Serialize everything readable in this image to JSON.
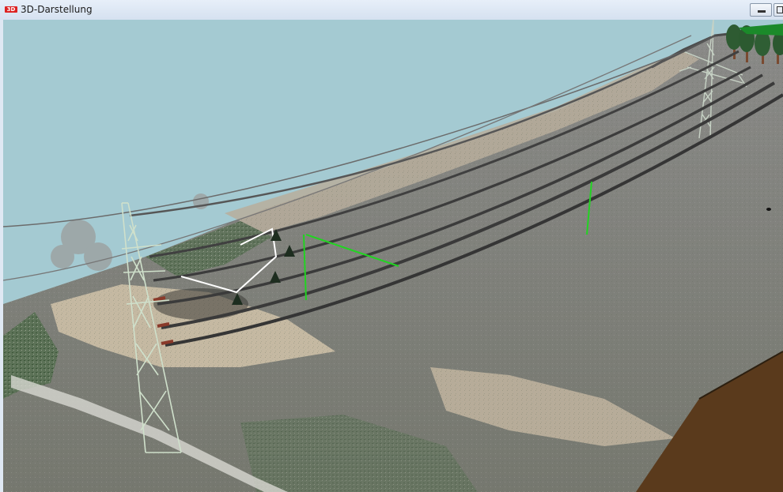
{
  "window": {
    "title": "3D-Darstellung",
    "app_icon_text": "3D",
    "minimize_icon": "minimize-icon",
    "restore_icon": "restore-icon"
  },
  "scene": {
    "type": "3d-point-cloud-view",
    "colors": {
      "sky": "#a4cad2",
      "ground": "#7d7d7d",
      "field": "#c7bba4",
      "soil": "#5a3a1c",
      "vegetation": "#4f6a4b",
      "conductor": "#3a3a3a",
      "marker_green": "#22d322",
      "marker_white": "#ffffff"
    },
    "objects": [
      "pylon-left",
      "pylon-right",
      "power-lines",
      "trees",
      "green-measurement-lines",
      "white-polygon-outline",
      "soil-block"
    ]
  }
}
